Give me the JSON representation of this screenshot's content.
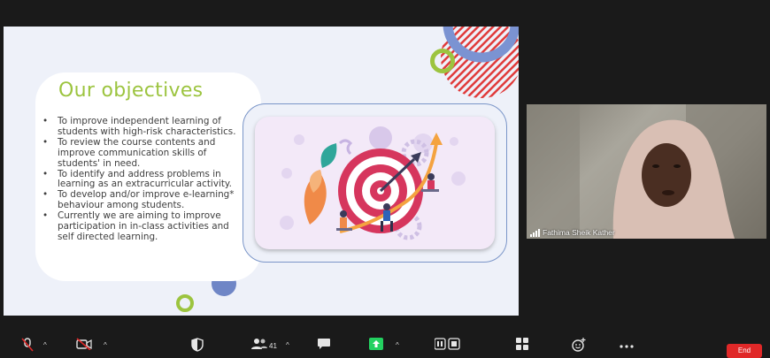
{
  "colors": {
    "title_green": "#9cc43f",
    "frame_blue": "#7a95c8",
    "circle_blue": "#6f86c6",
    "stripe_red": "#e03a3a",
    "end_red": "#e02828"
  },
  "slide": {
    "title": "Our objectives",
    "objectives": [
      "To improve independent learning of students with high-risk characteristics.",
      "To review the course contents and improve communication skills of students' in need.",
      "To identify and address problems in learning as an extracurricular activity.",
      "To develop and/or improve e-learning* behaviour among students.",
      "Currently we are aiming to improve participation in in-class activities and self directed learning."
    ],
    "illustration": "target-with-arrow-and-people-illustration"
  },
  "participant": {
    "name": "Fathima Sheik Kather"
  },
  "toolbar": {
    "participants_count": "41",
    "end_label": "End",
    "icons": [
      "microphone-muted-icon",
      "video-off-icon",
      "security-icon",
      "participants-icon",
      "chat-icon",
      "share-screen-icon",
      "record-icon",
      "apps-icon",
      "reactions-icon",
      "more-icon"
    ]
  }
}
